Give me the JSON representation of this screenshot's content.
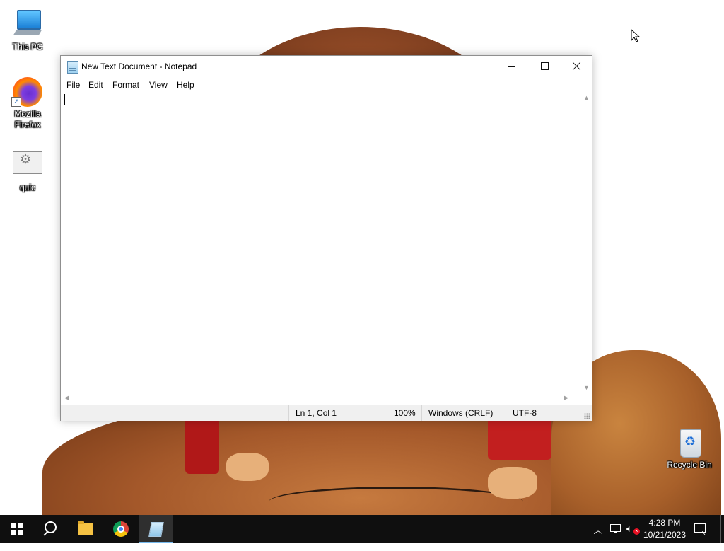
{
  "desktop": {
    "icons": [
      {
        "label": "This PC"
      },
      {
        "label": "Mozilla Firefox"
      },
      {
        "label": "quic"
      },
      {
        "label": "Recycle Bin"
      }
    ]
  },
  "notepad": {
    "title": "New Text Document - Notepad",
    "menu": [
      "File",
      "Edit",
      "Format",
      "View",
      "Help"
    ],
    "content": "",
    "status": {
      "position": "Ln 1, Col 1",
      "zoom": "100%",
      "line_ending": "Windows (CRLF)",
      "encoding": "UTF-8"
    }
  },
  "taskbar": {
    "pinned": [
      "start-icon",
      "search-icon",
      "file-explorer-icon",
      "chrome-icon",
      "notepad-icon"
    ],
    "active_app": "notepad",
    "clock": {
      "time": "4:28 PM",
      "date": "10/21/2023"
    },
    "tray": [
      "chevron-up-icon",
      "network-icon",
      "volume-muted-icon",
      "notification-icon"
    ]
  },
  "colors": {
    "taskbar": "#0f0f0f",
    "accent": "#76b9ed",
    "statusbar": "#f0f0f0"
  }
}
